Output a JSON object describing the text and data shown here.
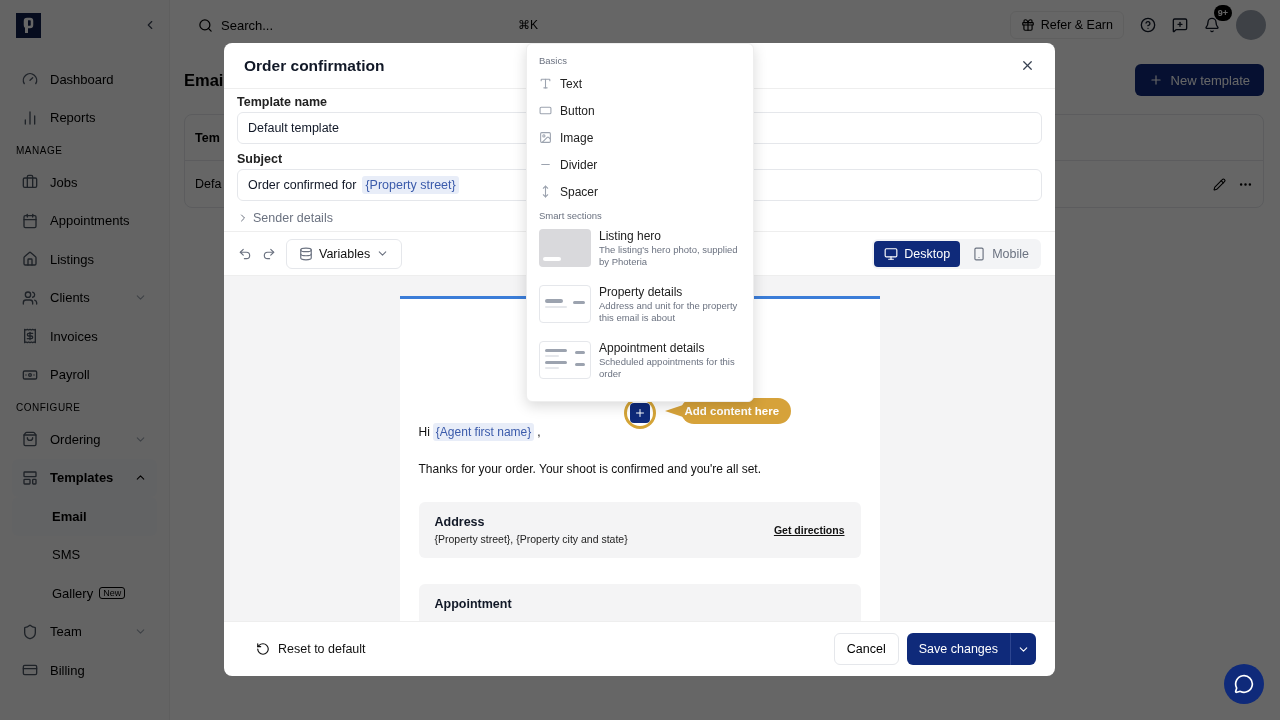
{
  "sidebar": {
    "items": [
      {
        "kind": "item",
        "label": "Dashboard",
        "selected": false
      },
      {
        "kind": "item",
        "label": "Reports",
        "selected": false
      },
      {
        "kind": "section",
        "label": "MANAGE"
      },
      {
        "kind": "item",
        "label": "Jobs",
        "selected": false
      },
      {
        "kind": "item",
        "label": "Appointments",
        "selected": false
      },
      {
        "kind": "item",
        "label": "Listings",
        "selected": false
      },
      {
        "kind": "item",
        "label": "Clients",
        "selected": false,
        "expanded": false
      },
      {
        "kind": "item",
        "label": "Invoices",
        "selected": false
      },
      {
        "kind": "item",
        "label": "Payroll",
        "selected": false
      },
      {
        "kind": "section",
        "label": "CONFIGURE"
      },
      {
        "kind": "item",
        "label": "Ordering",
        "selected": false,
        "expanded": false
      },
      {
        "kind": "item",
        "label": "Templates",
        "selected": true,
        "expanded": true,
        "children": [
          {
            "label": "Email",
            "selected": true
          },
          {
            "label": "SMS",
            "selected": false
          },
          {
            "label": "Gallery",
            "selected": false,
            "badge": "New"
          }
        ]
      },
      {
        "kind": "item",
        "label": "Team",
        "selected": false,
        "expanded": false
      },
      {
        "kind": "item",
        "label": "Billing",
        "selected": false
      }
    ]
  },
  "topbar": {
    "search_placeholder": "Search...",
    "shortcut": "⌘K",
    "refer": "Refer & Earn",
    "notification_badge": "9+"
  },
  "page": {
    "title": "Emai",
    "new_template": "New template",
    "table_header": "Tem",
    "table_row": "Defa"
  },
  "modal": {
    "title": "Order confirmation",
    "template_name": {
      "label": "Template name",
      "value": "Default template"
    },
    "subject": {
      "label": "Subject",
      "text": "Order confirmed for",
      "variable": "{Property street}"
    },
    "sender_details": {
      "label": "Sender details",
      "expanded": false
    },
    "variables_button": "Variables",
    "view_toggle": [
      {
        "label": "Desktop",
        "selected": true
      },
      {
        "label": "Mobile",
        "selected": false
      }
    ],
    "insert_menu": {
      "sections": [
        {
          "title": "Basics",
          "items": [
            {
              "kind": "basic",
              "label": "Text"
            },
            {
              "kind": "basic",
              "label": "Button"
            },
            {
              "kind": "basic",
              "label": "Image"
            },
            {
              "kind": "basic",
              "label": "Divider"
            },
            {
              "kind": "basic",
              "label": "Spacer"
            }
          ]
        },
        {
          "title": "Smart sections",
          "items": [
            {
              "kind": "smart",
              "label": "Listing hero",
              "description": "The listing's hero photo, supplied by Photeria"
            },
            {
              "kind": "smart",
              "label": "Property details",
              "description": "Address and unit for the property this email is about"
            },
            {
              "kind": "smart",
              "label": "Appointment details",
              "description": "Scheduled appointments for this order"
            }
          ]
        }
      ]
    },
    "callout": "Add content here",
    "email": {
      "greeting": "Hi",
      "greeting_variable": "{Agent first name}",
      "greeting_end": ",",
      "body": "Thanks for your order. Your shoot is confirmed and you're all set.",
      "cards": [
        {
          "title": "Address",
          "text": "{Property street}, {Property city and state}",
          "link": "Get directions"
        },
        {
          "title": "Appointment"
        }
      ]
    },
    "footer": {
      "reset": "Reset to default",
      "cancel": "Cancel",
      "save": "Save changes"
    }
  }
}
